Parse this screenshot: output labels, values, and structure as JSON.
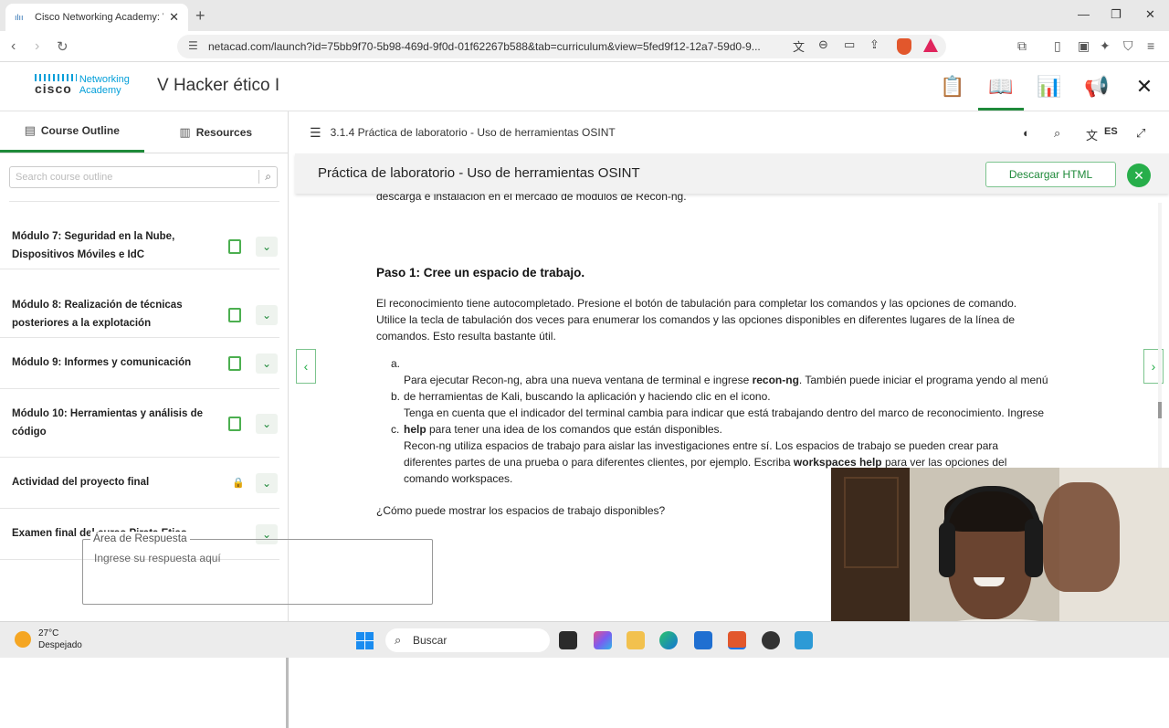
{
  "browser": {
    "tab_title": "Cisco Networking Academy: V H",
    "url": "netacad.com/launch?id=75bb9f70-5b98-469d-9f0d-01f62267b588&tab=curriculum&view=5fed9f12-12a7-59d0-9..."
  },
  "header": {
    "logo_brand": "cisco",
    "logo_line1": "Networking",
    "logo_line2": "Academy",
    "course_title": "V Hacker ético I",
    "icons": [
      "clipboard-icon",
      "book-icon",
      "chart-icon",
      "megaphone-icon",
      "close-icon"
    ]
  },
  "sidebar": {
    "tabs": [
      {
        "label": "Course Outline",
        "active": true
      },
      {
        "label": "Resources",
        "active": false
      }
    ],
    "search_placeholder": "Search course outline",
    "modules": [
      {
        "label": "Módulo 7: Seguridad en la Nube, Dispositivos Móviles e IdC",
        "icon": "clipboard"
      },
      {
        "label": "Módulo 8: Realización de técnicas posteriores a la explotación",
        "icon": "clipboard"
      },
      {
        "label": "Módulo 9: Informes y comunicación",
        "icon": "clipboard"
      },
      {
        "label": "Módulo 10: Herramientas y análisis de código",
        "icon": "clipboard"
      },
      {
        "label": "Actividad del proyecto final",
        "icon": "lock"
      },
      {
        "label": "Examen final del curso Pirata Etico",
        "icon": "none"
      }
    ]
  },
  "content": {
    "breadcrumb": "3.1.4 Práctica de laboratorio - Uso de herramientas OSINT",
    "language": "ES",
    "page_title": "Práctica de laboratorio - Uso de herramientas OSINT",
    "download_label": "Descargar HTML",
    "cut_text": "descarga e instalación en el mercado de módulos de Recon-ng.",
    "step_heading": "Paso 1: Cree un espacio de trabajo.",
    "intro_line1": "El reconocimiento tiene autocompletado. Presione el botón de tabulación para completar los comandos y las opciones de comando.",
    "intro_line2": "Utilice la tecla de tabulación dos veces para enumerar los comandos y las opciones disponibles en diferentes lugares de la línea de",
    "intro_line3": "comandos. Esto resulta bastante útil.",
    "items": [
      {
        "marker": "a.",
        "line1_pre": "Para ejecutar Recon-ng, abra una nueva ventana de terminal e ingrese ",
        "line1_bold": "recon-ng",
        "line1_post": ". También puede iniciar el programa yendo al menú",
        "line2": "de herramientas de Kali, buscando la aplicación y haciendo clic en el icono."
      },
      {
        "marker": "b.",
        "line1": "Tenga en cuenta que el indicador del terminal cambia para indicar que está trabajando dentro del marco de reconocimiento. Ingrese",
        "line2_bold": "help",
        "line2_post": " para tener una idea de los comandos que están disponibles."
      },
      {
        "marker": "c.",
        "line1": "Recon-ng utiliza espacios de trabajo para aislar las investigaciones entre sí. Los espacios de trabajo se pueden crear para",
        "line2_pre": "diferentes partes de una prueba o para diferentes clientes, por ejemplo. Escriba ",
        "line2_bold": "workspaces help",
        "line2_post": " para ver las opciones del",
        "line3": "comando workspaces."
      }
    ],
    "question": "¿Cómo puede mostrar los espacios de trabajo disponibles?",
    "answer_legend": "Área de Respuesta",
    "answer_placeholder": "Ingrese su respuesta aquí"
  },
  "taskbar": {
    "temperature": "27°C",
    "weather": "Despejado",
    "search_label": "Buscar"
  },
  "colors": {
    "accent_green": "#1f8a3a",
    "cisco_blue": "#049fd9"
  }
}
